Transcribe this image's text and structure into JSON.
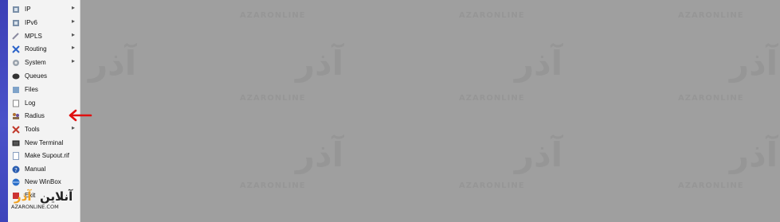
{
  "menu": {
    "items": [
      {
        "label": "IP",
        "icon": "ip-icon",
        "submenu": true
      },
      {
        "label": "IPv6",
        "icon": "ipv6-icon",
        "submenu": true
      },
      {
        "label": "MPLS",
        "icon": "mpls-icon",
        "submenu": true
      },
      {
        "label": "Routing",
        "icon": "routing-icon",
        "submenu": true
      },
      {
        "label": "System",
        "icon": "system-icon",
        "submenu": true
      },
      {
        "label": "Queues",
        "icon": "queues-icon",
        "submenu": false
      },
      {
        "label": "Files",
        "icon": "files-icon",
        "submenu": false
      },
      {
        "label": "Log",
        "icon": "log-icon",
        "submenu": false
      },
      {
        "label": "Radius",
        "icon": "radius-icon",
        "submenu": false
      },
      {
        "label": "Tools",
        "icon": "tools-icon",
        "submenu": true
      },
      {
        "label": "New Terminal",
        "icon": "terminal-icon",
        "submenu": false
      },
      {
        "label": "Make Supout.rif",
        "icon": "supout-icon",
        "submenu": false
      },
      {
        "label": "Manual",
        "icon": "manual-icon",
        "submenu": false
      },
      {
        "label": "New WinBox",
        "icon": "winbox-icon",
        "submenu": false
      },
      {
        "label": "Exit",
        "icon": "exit-icon",
        "submenu": false
      }
    ],
    "submenu_glyph": "▸"
  },
  "annotation": {
    "pointer": "red-arrow-icon",
    "color": "#e01010"
  },
  "logo": {
    "text": "آذر آنلاین",
    "subtext": "AZARONLINE.COM"
  },
  "watermark": {
    "text": "آذر",
    "small": "AZARONLINE"
  }
}
